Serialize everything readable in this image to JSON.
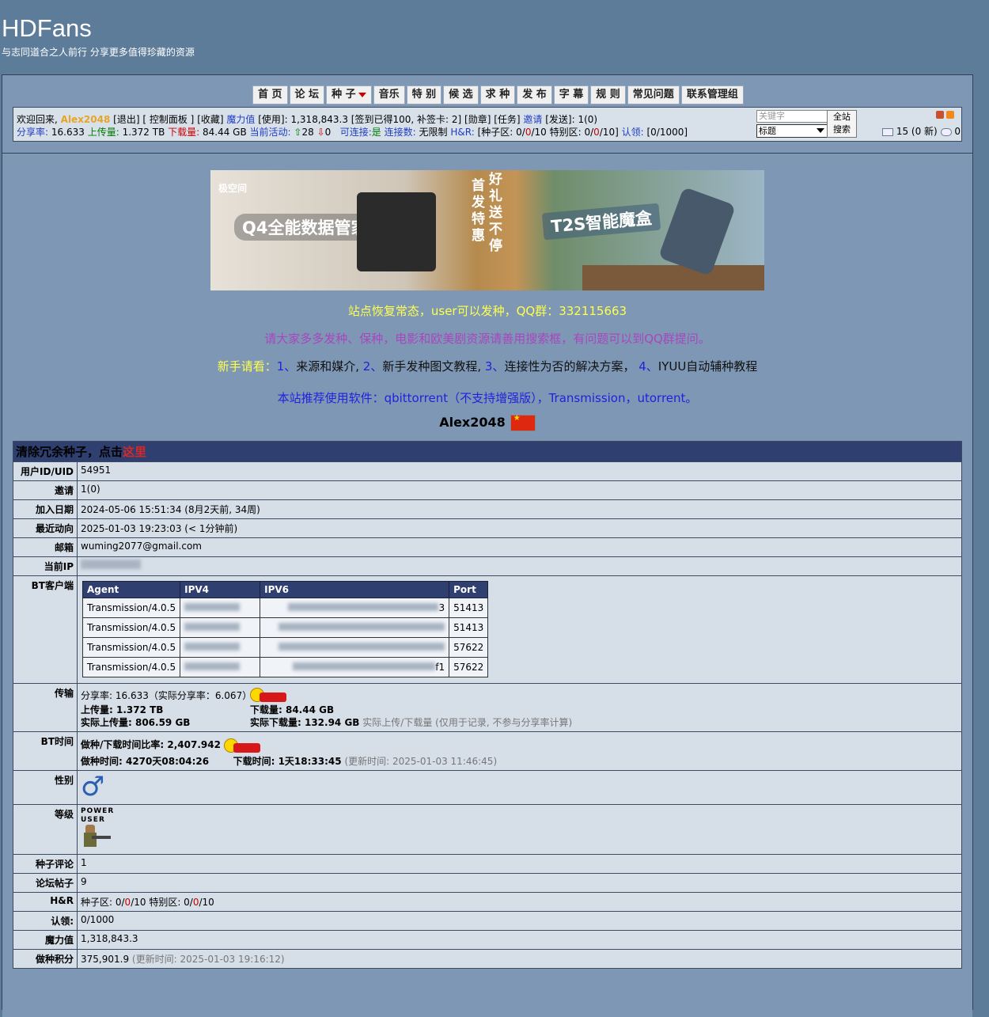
{
  "site": {
    "title": "HDFans",
    "slogan": "与志同道合之人前行 分享更多值得珍藏的资源"
  },
  "nav": [
    "首 页",
    "论 坛",
    "种 子",
    "音乐",
    "特 别",
    "候 选",
    "求 种",
    "发 布",
    "字 幕",
    "规 则",
    "常见问题",
    "联系管理组"
  ],
  "userbar": {
    "welcome": "欢迎回来,",
    "username": "Alex2048",
    "logout": "[退出]",
    "control": "[ 控制面板 ]",
    "favorites": "[收藏]",
    "bonus_label": "魔力值",
    "bonus_rest": "[使用]: 1,318,843.3 [签到已得100, 补签卡: 2] [勋章] [任务]",
    "invite_label": "邀请",
    "send_label": "[发送]: 1(0)",
    "ratio_label": "分享率:",
    "ratio": "16.633",
    "upload_label": "上传量:",
    "upload": "1.372 TB",
    "download_label": "下载量:",
    "download": "84.44 GB",
    "active_label": "当前活动:",
    "active_up": "28",
    "active_down": "0",
    "connectable_label": "可连接:",
    "connectable": "是",
    "slots_label": "连接数:",
    "slots": "无限制",
    "hr_label": "H&R:",
    "hr_pre": "[种子区: 0/",
    "hr_red": "0",
    "hr_mid": "/10 特别区: 0/",
    "hr_red2": "0",
    "hr_post": "/10]",
    "claim_label": "认领:",
    "claim": "[0/1000]",
    "messages": "15 (0 新)",
    "watchers": "0"
  },
  "search": {
    "placeholder": "关键字",
    "select": "标题",
    "button_line1": "全站",
    "button_line2": "搜索"
  },
  "banner": {
    "logo": "极空间",
    "q4": "Q4全能数据管家",
    "vert1": "首发特惠",
    "vert2": "好礼送不停",
    "t2s": "T2S智能魔盒"
  },
  "notices": {
    "n1": "站点恢复常态，user可以发种，QQ群：332115663",
    "n2": "请大家多多发种、保种，电影和欧美剧资源请善用搜索框，有问题可以到QQ群提问。",
    "n3_prefix": "新手请看：",
    "n3_i1": "1、",
    "n3_t1": "来源和媒介,",
    "n3_i2": " 2、",
    "n3_t2": "新手发种图文教程,",
    "n3_i3": " 3、",
    "n3_t3": "连接性为否的解决方案，",
    "n3_i4": "  4、",
    "n3_t4": "IYUU自动辅种教程",
    "n4": "本站推荐使用软件：qbittorrent（不支持增强版），Transmission，utorrent。"
  },
  "profile": {
    "name": "Alex2048",
    "header_text": "清除冗余种子，点击",
    "header_link": "这里",
    "uid_label": "用户ID/UID",
    "uid": "54951",
    "invite_label": "邀请",
    "invite": "1(0)",
    "join_label": "加入日期",
    "join": "2024-05-06 15:51:34 (8月2天前, 34周)",
    "last_label": "最近动向",
    "last": "2025-01-03 19:23:03 (< 1分钟前)",
    "email_label": "邮箱",
    "email": "wuming2077@gmail.com",
    "ip_label": "当前IP",
    "bt_label": "BT客户端",
    "bt_headers": [
      "Agent",
      "IPV4",
      "IPV6",
      "Port"
    ],
    "bt_rows": [
      {
        "agent": "Transmission/4.0.5",
        "ipv6_tail": "3",
        "port": "51413"
      },
      {
        "agent": "Transmission/4.0.5",
        "ipv6_tail": "",
        "port": "51413"
      },
      {
        "agent": "Transmission/4.0.5",
        "ipv6_tail": "",
        "port": "57622"
      },
      {
        "agent": "Transmission/4.0.5",
        "ipv6_tail": "f1",
        "port": "57622"
      }
    ],
    "transfer_label": "传输",
    "ratio_text": "分享率: 16.633（实际分享率：6.067）",
    "upload_text": "上传量: 1.372 TB",
    "real_upload_text": "实际上传量: 806.59 GB",
    "download_text": "下载量: 84.44 GB",
    "real_download_text": "实际下载量: 132.94 GB",
    "real_note": "实际上传/下载量 (仅用于记录, 不参与分享率计算)",
    "bttime_label": "BT时间",
    "seed_ratio_text": "做种/下载时间比率: 2,407.942",
    "seed_time_text": "做种时间: 4270天08:04:26",
    "leech_time_text": "下载时间: 1天18:33:45",
    "time_note": "(更新时间: 2025-01-03 11:46:45)",
    "gender_label": "性别",
    "gender_symbol": "♂",
    "class_label": "等级",
    "class_name": "POWER USER",
    "comments_label": "种子评论",
    "comments": "1",
    "posts_label": "论坛帖子",
    "posts": "9",
    "hr_label": "H&R",
    "hr_a": "种子区: 0/",
    "hr_b": "0",
    "hr_c": "/10 特别区: 0/",
    "hr_d": "0",
    "hr_e": "/10",
    "claim_label": "认领:",
    "claim": "0/1000",
    "bonus_label": "魔力值",
    "bonus": "1,318,843.3",
    "seedbonus_label": "做种积分",
    "seedbonus": "375,901.9",
    "seedbonus_note": "(更新时间: 2025-01-03 19:16:12)"
  },
  "colors": {
    "background": "#5d7c99",
    "panel": "#7d97b4",
    "header_bar": "#2f3f6f",
    "link": "#1f3cc0"
  }
}
